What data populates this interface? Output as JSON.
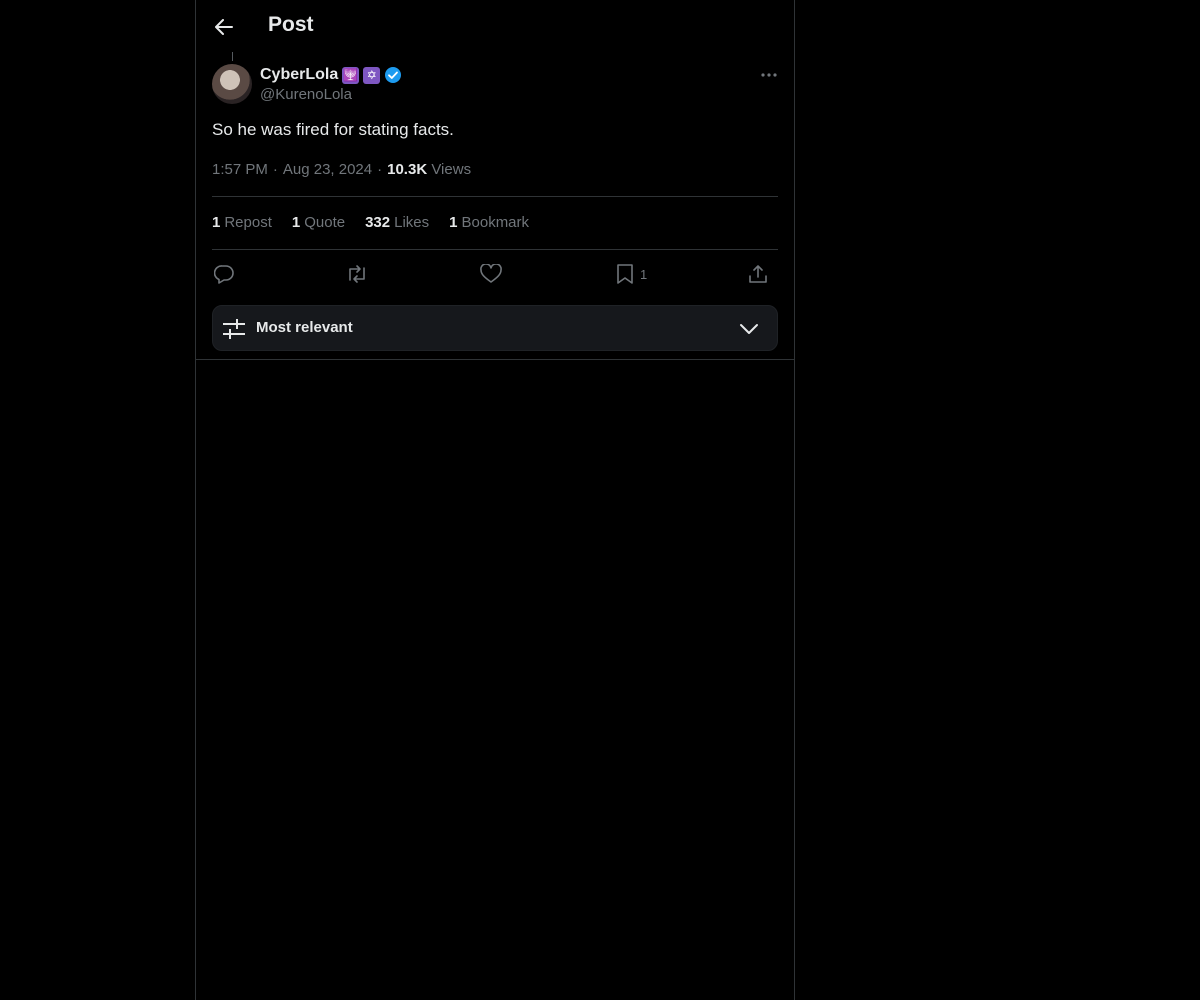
{
  "header": {
    "title": "Post",
    "back_icon": "arrow-left-icon"
  },
  "post": {
    "author": {
      "display_name": "CyberLola",
      "badges": [
        "🕎",
        "✡"
      ],
      "verified": true,
      "handle": "@KurenoLola"
    },
    "text": "So he was fired for stating facts.",
    "time": "1:57 PM",
    "separator": "·",
    "date": "Aug 23, 2024",
    "views_count": "10.3K",
    "views_label": "Views"
  },
  "stats": {
    "reposts": {
      "count": "1",
      "label": "Repost"
    },
    "quotes": {
      "count": "1",
      "label": "Quote"
    },
    "likes": {
      "count": "332",
      "label": "Likes"
    },
    "bookmarks": {
      "count": "1",
      "label": "Bookmark"
    }
  },
  "actions": {
    "reply_icon": "reply-icon",
    "repost_icon": "repost-icon",
    "like_icon": "heart-icon",
    "bookmark_icon": "bookmark-icon",
    "bookmark_count": "1",
    "share_icon": "share-icon"
  },
  "sort": {
    "label": "Most relevant",
    "icon": "sliders-icon",
    "chevron": "chevron-down-icon"
  },
  "colors": {
    "background": "#000000",
    "text_primary": "#e7e9ea",
    "text_secondary": "#71767b",
    "border": "#2f3336",
    "verified": "#1d9bf0",
    "badge": "#7e57c2"
  }
}
